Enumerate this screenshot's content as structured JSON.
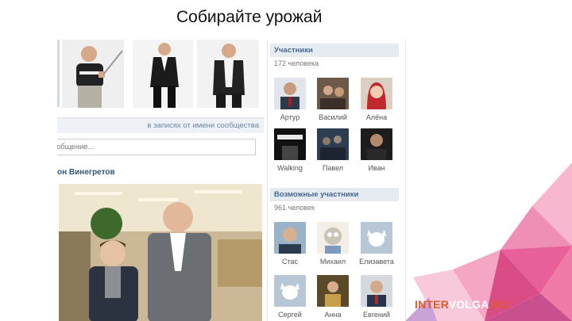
{
  "slide": {
    "title": "Собирайте урожай"
  },
  "post": {
    "scope_label": "в записях от имени сообщества",
    "input_placeholder": "общение...",
    "author": "он Винегретов"
  },
  "members": {
    "header": "Участники",
    "count": "172 человека",
    "items": [
      {
        "name": "Артур",
        "avatar": "tie-man"
      },
      {
        "name": "Василий",
        "avatar": "crowd"
      },
      {
        "name": "Алёна",
        "avatar": "woman-red-scarf"
      },
      {
        "name": "Walking",
        "avatar": "poster"
      },
      {
        "name": "Павел",
        "avatar": "group-dark"
      },
      {
        "name": "Иван",
        "avatar": "man-dark"
      }
    ]
  },
  "possible_members": {
    "header": "Возможные участники",
    "count": "961 человек",
    "items": [
      {
        "name": "Стас",
        "avatar": "man-photo"
      },
      {
        "name": "Михаил",
        "avatar": "cartoon"
      },
      {
        "name": "Елизавета",
        "avatar": "default-dog"
      },
      {
        "name": "Сергей",
        "avatar": "default-dog"
      },
      {
        "name": "Анна",
        "avatar": "woman-photo"
      },
      {
        "name": "Евгений",
        "avatar": "man-suit"
      }
    ]
  },
  "brand": {
    "part1": "INTER",
    "part2": "VOLGA",
    "part3": ".RU"
  },
  "colors": {
    "accent": "#45688e",
    "header_bg": "#e6ebf1",
    "brand_orange": "#e05a2a",
    "deco_pink": "#e8609a"
  }
}
